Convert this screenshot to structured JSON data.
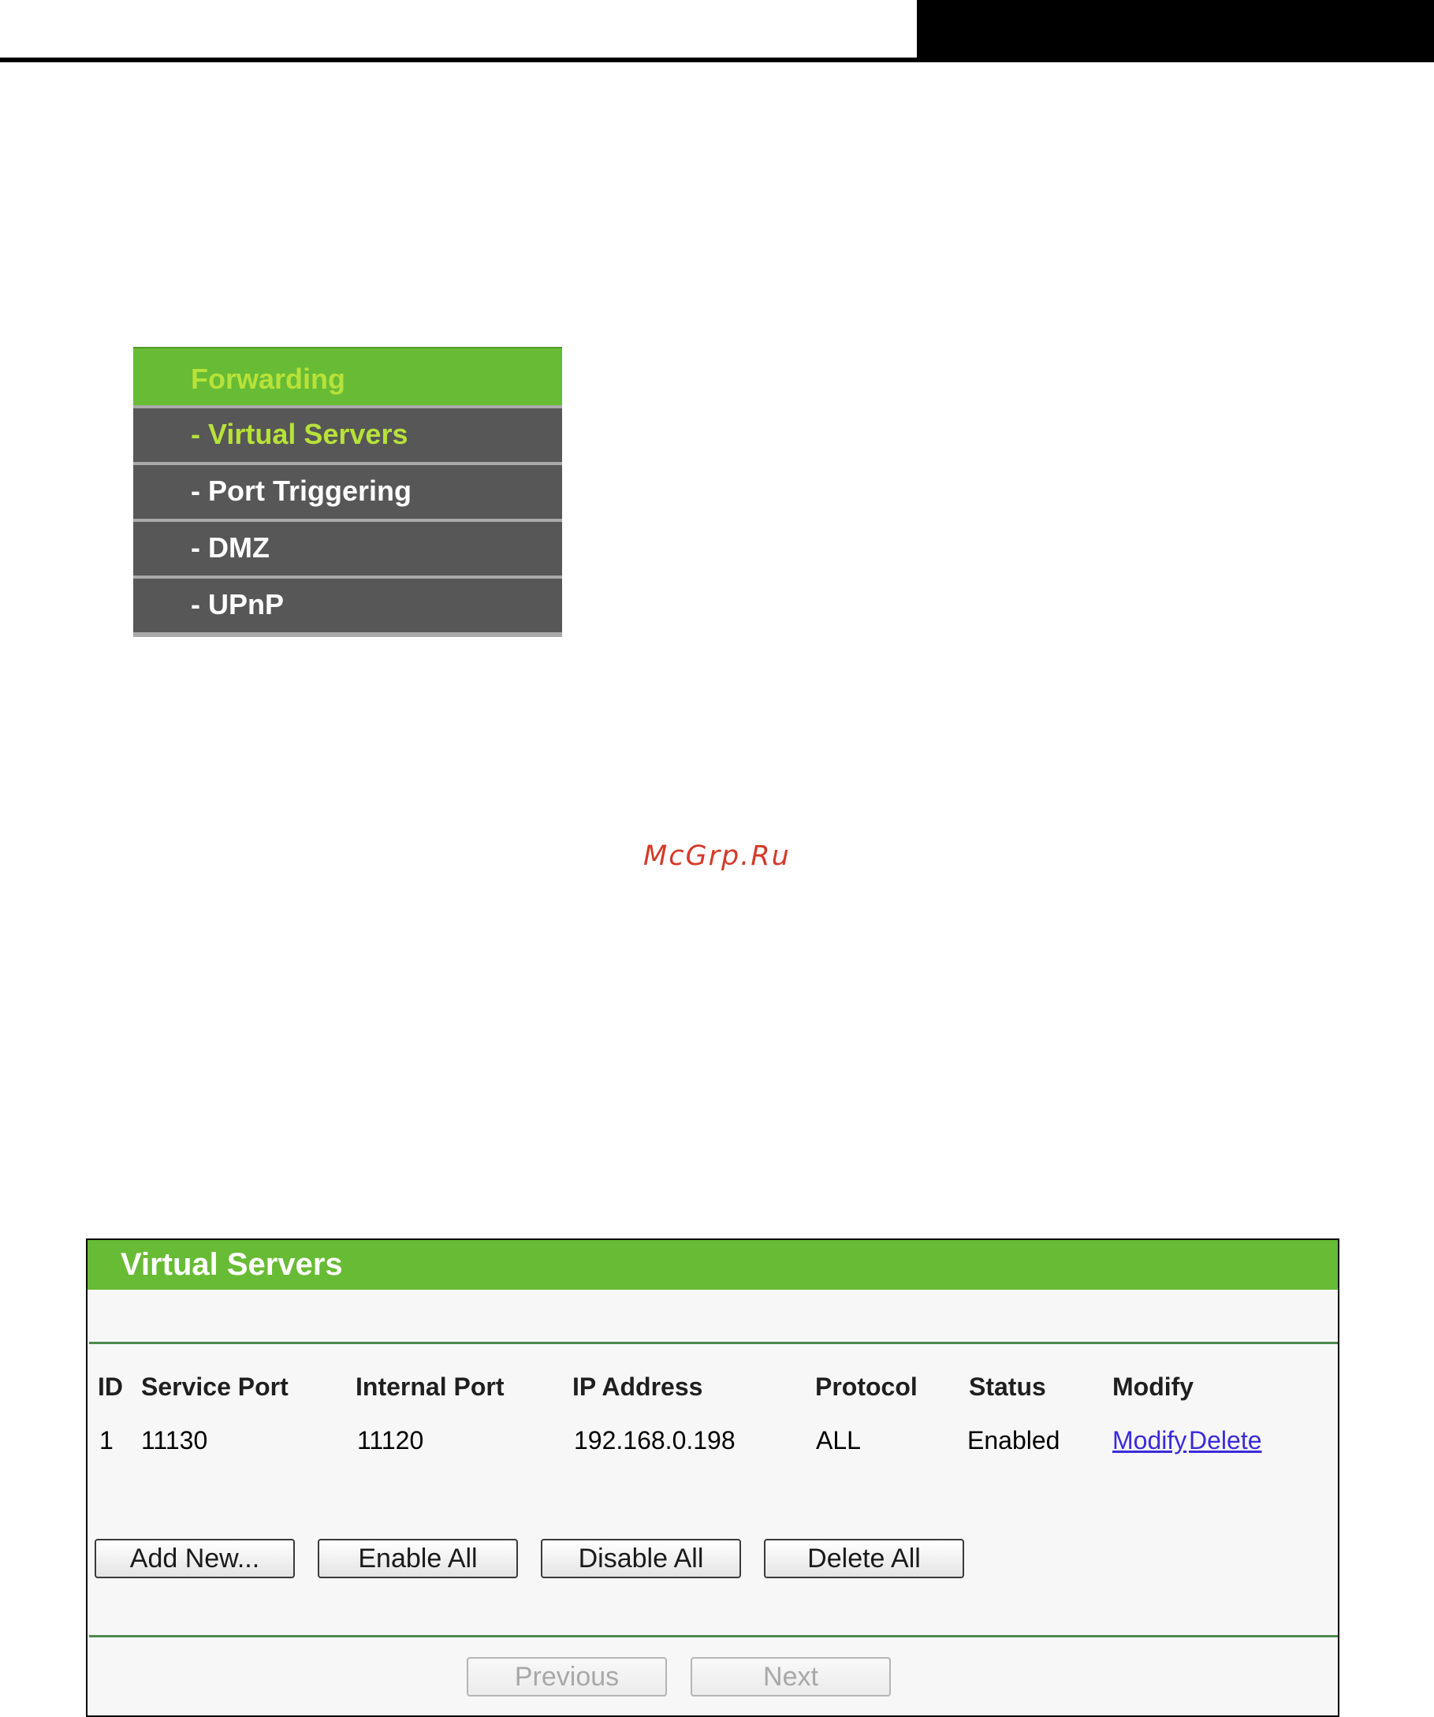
{
  "menu": {
    "header": "Forwarding",
    "items": [
      {
        "label": "- Virtual Servers",
        "active": true
      },
      {
        "label": "- Port Triggering",
        "active": false
      },
      {
        "label": "- DMZ",
        "active": false
      },
      {
        "label": "- UPnP",
        "active": false
      }
    ]
  },
  "watermark": "McGrp.Ru",
  "panel": {
    "title": "Virtual Servers",
    "columns": [
      "ID",
      "Service Port",
      "Internal Port",
      "IP Address",
      "Protocol",
      "Status",
      "Modify"
    ],
    "rows": [
      {
        "id": "1",
        "service_port": "11130",
        "internal_port": "11120",
        "ip_address": "192.168.0.198",
        "protocol": "ALL",
        "status": "Enabled",
        "modify_label": "Modify",
        "delete_label": "Delete"
      }
    ],
    "buttons": {
      "add_new": "Add New...",
      "enable_all": "Enable All",
      "disable_all": "Disable All",
      "delete_all": "Delete All"
    },
    "pagination": {
      "previous": "Previous",
      "next": "Next"
    }
  },
  "colors": {
    "accent_green": "#68bb34",
    "menu_gray": "#575757",
    "active_text": "#b7e23a",
    "link_blue": "#3b2bd8"
  }
}
